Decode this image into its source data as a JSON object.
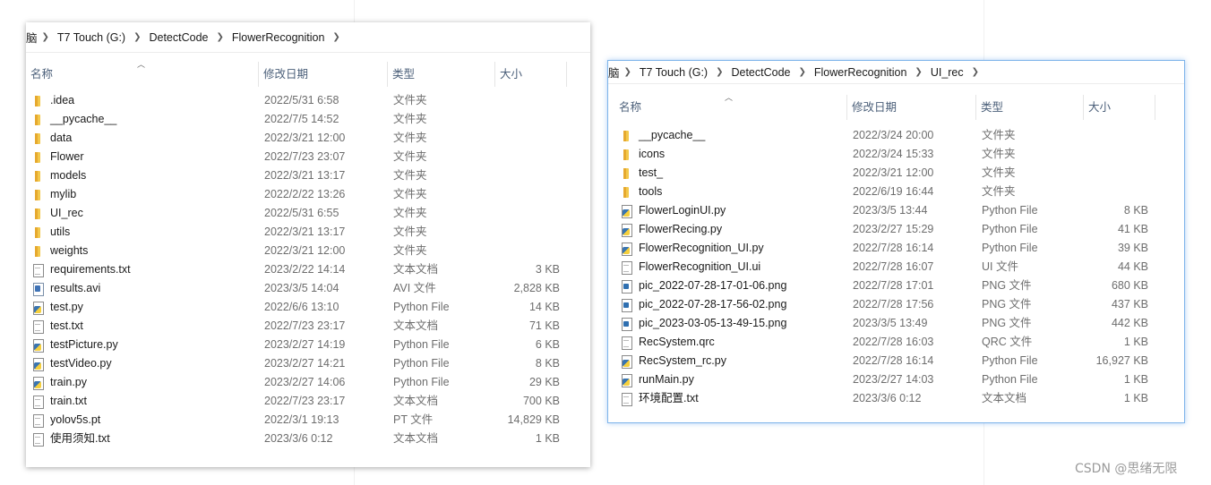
{
  "watermark": "CSDN @思绪无限",
  "windows": [
    {
      "breadcrumb": [
        "T7 Touch (G:)",
        "DetectCode",
        "FlowerRecognition"
      ],
      "breadcrumb_cut": "脑",
      "headers": {
        "name": "名称",
        "date": "修改日期",
        "type": "类型",
        "size": "大小"
      },
      "rows": [
        {
          "name": ".idea",
          "date": "2022/5/31 6:58",
          "type": "文件夹",
          "size": "",
          "icon": "folder-icon"
        },
        {
          "name": "__pycache__",
          "date": "2022/7/5 14:52",
          "type": "文件夹",
          "size": "",
          "icon": "folder-icon"
        },
        {
          "name": "data",
          "date": "2022/3/21 12:00",
          "type": "文件夹",
          "size": "",
          "icon": "folder-icon"
        },
        {
          "name": "Flower",
          "date": "2022/7/23 23:07",
          "type": "文件夹",
          "size": "",
          "icon": "folder-icon"
        },
        {
          "name": "models",
          "date": "2022/3/21 13:17",
          "type": "文件夹",
          "size": "",
          "icon": "folder-icon"
        },
        {
          "name": "mylib",
          "date": "2022/2/22 13:26",
          "type": "文件夹",
          "size": "",
          "icon": "folder-icon"
        },
        {
          "name": "UI_rec",
          "date": "2022/5/31 6:55",
          "type": "文件夹",
          "size": "",
          "icon": "folder-icon"
        },
        {
          "name": "utils",
          "date": "2022/3/21 13:17",
          "type": "文件夹",
          "size": "",
          "icon": "folder-icon"
        },
        {
          "name": "weights",
          "date": "2022/3/21 12:00",
          "type": "文件夹",
          "size": "",
          "icon": "folder-icon"
        },
        {
          "name": "requirements.txt",
          "date": "2023/2/22 14:14",
          "type": "文本文档",
          "size": "3 KB",
          "icon": "text-file-icon"
        },
        {
          "name": "results.avi",
          "date": "2023/3/5 14:04",
          "type": "AVI 文件",
          "size": "2,828 KB",
          "icon": "video-file-icon"
        },
        {
          "name": "test.py",
          "date": "2022/6/6 13:10",
          "type": "Python File",
          "size": "14 KB",
          "icon": "python-file-icon"
        },
        {
          "name": "test.txt",
          "date": "2022/7/23 23:17",
          "type": "文本文档",
          "size": "71 KB",
          "icon": "text-file-icon"
        },
        {
          "name": "testPicture.py",
          "date": "2023/2/27 14:19",
          "type": "Python File",
          "size": "6 KB",
          "icon": "python-file-icon"
        },
        {
          "name": "testVideo.py",
          "date": "2023/2/27 14:21",
          "type": "Python File",
          "size": "8 KB",
          "icon": "python-file-icon"
        },
        {
          "name": "train.py",
          "date": "2023/2/27 14:06",
          "type": "Python File",
          "size": "29 KB",
          "icon": "python-file-icon"
        },
        {
          "name": "train.txt",
          "date": "2022/7/23 23:17",
          "type": "文本文档",
          "size": "700 KB",
          "icon": "text-file-icon"
        },
        {
          "name": "yolov5s.pt",
          "date": "2022/3/1 19:13",
          "type": "PT 文件",
          "size": "14,829 KB",
          "icon": "blank-file-icon"
        },
        {
          "name": "使用须知.txt",
          "date": "2023/3/6 0:12",
          "type": "文本文档",
          "size": "1 KB",
          "icon": "text-file-icon"
        }
      ]
    },
    {
      "breadcrumb": [
        "T7 Touch (G:)",
        "DetectCode",
        "FlowerRecognition",
        "UI_rec"
      ],
      "breadcrumb_cut": "脑",
      "headers": {
        "name": "名称",
        "date": "修改日期",
        "type": "类型",
        "size": "大小"
      },
      "rows": [
        {
          "name": "__pycache__",
          "date": "2022/3/24 20:00",
          "type": "文件夹",
          "size": "",
          "icon": "folder-icon"
        },
        {
          "name": "icons",
          "date": "2022/3/24 15:33",
          "type": "文件夹",
          "size": "",
          "icon": "folder-icon"
        },
        {
          "name": "test_",
          "date": "2022/3/21 12:00",
          "type": "文件夹",
          "size": "",
          "icon": "folder-icon"
        },
        {
          "name": "tools",
          "date": "2022/6/19 16:44",
          "type": "文件夹",
          "size": "",
          "icon": "folder-icon"
        },
        {
          "name": "FlowerLoginUI.py",
          "date": "2023/3/5 13:44",
          "type": "Python File",
          "size": "8 KB",
          "icon": "python-file-icon"
        },
        {
          "name": "FlowerRecing.py",
          "date": "2023/2/27 15:29",
          "type": "Python File",
          "size": "41 KB",
          "icon": "python-file-icon"
        },
        {
          "name": "FlowerRecognition_UI.py",
          "date": "2022/7/28 16:14",
          "type": "Python File",
          "size": "39 KB",
          "icon": "python-file-icon"
        },
        {
          "name": "FlowerRecognition_UI.ui",
          "date": "2022/7/28 16:07",
          "type": "UI 文件",
          "size": "44 KB",
          "icon": "blank-file-icon"
        },
        {
          "name": "pic_2022-07-28-17-01-06.png",
          "date": "2022/7/28 17:01",
          "type": "PNG 文件",
          "size": "680 KB",
          "icon": "image-file-icon"
        },
        {
          "name": "pic_2022-07-28-17-56-02.png",
          "date": "2022/7/28 17:56",
          "type": "PNG 文件",
          "size": "437 KB",
          "icon": "image-file-icon"
        },
        {
          "name": "pic_2023-03-05-13-49-15.png",
          "date": "2023/3/5 13:49",
          "type": "PNG 文件",
          "size": "442 KB",
          "icon": "image-file-icon"
        },
        {
          "name": "RecSystem.qrc",
          "date": "2022/7/28 16:03",
          "type": "QRC 文件",
          "size": "1 KB",
          "icon": "blank-file-icon"
        },
        {
          "name": "RecSystem_rc.py",
          "date": "2022/7/28 16:14",
          "type": "Python File",
          "size": "16,927 KB",
          "icon": "python-file-icon"
        },
        {
          "name": "runMain.py",
          "date": "2023/2/27 14:03",
          "type": "Python File",
          "size": "1 KB",
          "icon": "python-file-icon"
        },
        {
          "name": "环境配置.txt",
          "date": "2023/3/6 0:12",
          "type": "文本文档",
          "size": "1 KB",
          "icon": "text-file-icon"
        }
      ]
    }
  ]
}
